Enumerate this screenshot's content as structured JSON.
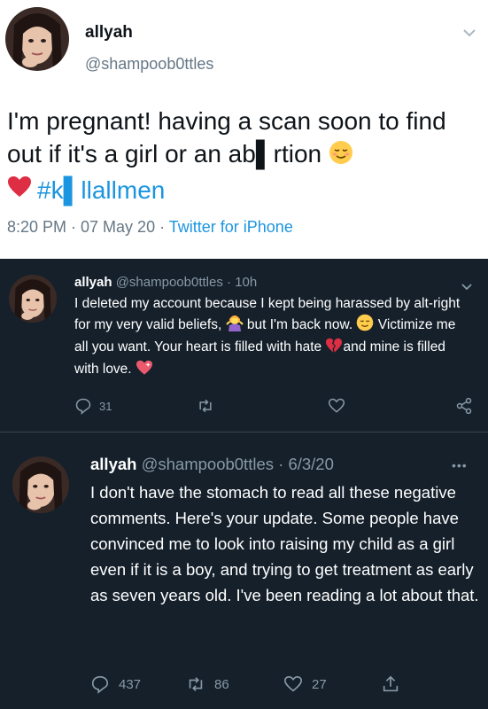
{
  "tweet1": {
    "author_name": "allyah",
    "author_handle": "@shampoob0ttles",
    "text": "I'm pregnant! having a scan soon to find out if it's a girl or an ab▌rtion",
    "hashtag": "#k▌llallmen",
    "timestamp": "8:20 PM · 07 May 20 · ",
    "source": "Twitter for iPhone",
    "icons": [
      "avatar",
      "chevron-down-icon",
      "relieved-face-emoji",
      "red-heart-emoji"
    ]
  },
  "tweet2": {
    "author_name": "allyah",
    "author_handle": "@shampoob0ttles",
    "separator": "·",
    "time": "10h",
    "text_part1": "I deleted my account because I kept being harassed by alt-right for my very valid beliefs,",
    "text_part2": " but I'm back now.",
    "text_part3": " Victimize me all you want. Your heart is filled with hate",
    "text_part4": "and mine is filled with love.",
    "reply_count": "31",
    "icons": [
      "avatar",
      "chevron-down-icon",
      "woman-shrugging-emoji",
      "relieved-face-emoji",
      "broken-heart-emoji",
      "sparkling-heart-emoji",
      "reply-icon",
      "retweet-icon",
      "like-icon",
      "share-icon"
    ]
  },
  "tweet3": {
    "author_name": "allyah",
    "author_handle": "@shampoob0ttles",
    "separator": "·",
    "date": "6/3/20",
    "more": "•••",
    "text": "I don't have the stomach to read all these negative comments. Here's your update. Some people have convinced me to look into raising my child as a girl even if it is a boy, and trying to get treatment as early as seven years old. I've been reading a lot about that.",
    "reply_count": "437",
    "retweet_count": "86",
    "like_count": "27",
    "icons": [
      "avatar",
      "more-icon",
      "reply-icon",
      "retweet-icon",
      "like-icon",
      "share-icon"
    ]
  },
  "colors": {
    "dark_bg": "#15202b",
    "light_bg": "#ffffff",
    "secondary_text": "#8899a6",
    "link_blue": "#1b95e0",
    "divider": "#38444d"
  }
}
